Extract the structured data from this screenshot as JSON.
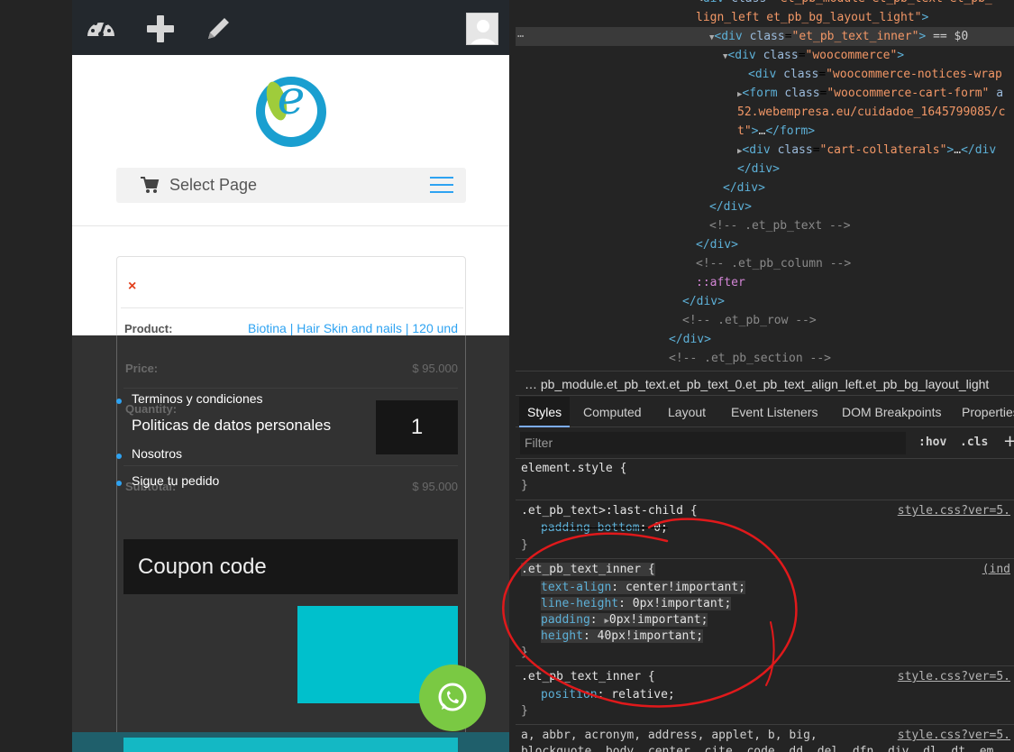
{
  "site": {
    "logo_letter": "e",
    "nav": {
      "label": "Select Page"
    },
    "cart": {
      "remove_symbol": "×",
      "product_label": "Product:",
      "product_value": "Biotina | Hair Skin and nails | 120 und",
      "price_label": "Price:",
      "price_value": "$ 95.000",
      "quantity_label": "Quantity:",
      "quantity_value": "1",
      "subtotal_label": "Subtotal:",
      "subtotal_value": "$ 95.000",
      "coupon_placeholder": "Coupon code"
    },
    "footer_links": [
      "Terminos y condiciones",
      "Politicas de datos personales",
      "Nosotros",
      "Sigue tu pedido"
    ]
  },
  "devtools": {
    "elements": [
      {
        "indent": 0,
        "html": "<span class=\"txt\">  &lt;</span><span class=\"tag\">div</span> <span class=\"attr\">class</span>=<span class=\"aval\">\"et_pb_module et_pb_text et_pb_</span>"
      },
      {
        "indent": 0,
        "html": "<span class=\"aval\">lign_left et_pb_bg_layout_light\"</span><span class=\"tag\">&gt;</span>"
      },
      {
        "indent": 0,
        "html": "<span class=\"tri\">▼</span><span class=\"tag\">&lt;div</span> <span class=\"attr\">class</span>=<span class=\"aval\">\"et_pb_text_inner\"</span><span class=\"tag\">&gt;</span> <span class=\"txt\">== $0</span>"
      },
      {
        "indent": 0,
        "html": "<span class=\"tri\">▼</span><span class=\"tag\">&lt;div</span> <span class=\"attr\">class</span>=<span class=\"aval\">\"woocommerce\"</span><span class=\"tag\">&gt;</span>"
      },
      {
        "indent": 0,
        "html": "<span class=\"tag\">&lt;div</span> <span class=\"attr\">class</span>=<span class=\"aval\">\"woocommerce-notices-wrap</span>"
      },
      {
        "indent": 0,
        "html": "<span class=\"tri\">▶</span><span class=\"tag\">&lt;form</span> <span class=\"attr\">class</span>=<span class=\"aval\">\"woocommerce-cart-form\"</span> <span class=\"attr\">a</span>"
      },
      {
        "indent": 0,
        "html": "<span class=\"aval\">52.webempresa.eu/cuidadoe_1645799085/c</span>"
      },
      {
        "indent": 0,
        "html": "<span class=\"aval\">t\"</span><span class=\"tag\">&gt;</span><span class=\"txt\">…</span><span class=\"tag\">&lt;/form&gt;</span>"
      },
      {
        "indent": 0,
        "html": "<span class=\"tri\">▶</span><span class=\"tag\">&lt;div</span> <span class=\"attr\">class</span>=<span class=\"aval\">\"cart-collaterals\"</span><span class=\"tag\">&gt;</span><span class=\"txt\">…</span><span class=\"tag\">&lt;/div</span>"
      },
      {
        "indent": 0,
        "html": "<span class=\"tag\">&lt;/div&gt;</span>"
      },
      {
        "indent": 0,
        "html": "<span class=\"tag\">&lt;/div&gt;</span>"
      },
      {
        "indent": 0,
        "html": "<span class=\"tag\">&lt;/div&gt;</span>"
      },
      {
        "indent": 0,
        "html": "<span class=\"cmt\">&lt;!-- .et_pb_text --&gt;</span>"
      },
      {
        "indent": 0,
        "html": "<span class=\"tag\">&lt;/div&gt;</span>"
      },
      {
        "indent": 0,
        "html": "<span class=\"cmt\">&lt;!-- .et_pb_column --&gt;</span>"
      },
      {
        "indent": 0,
        "html": "<span class=\"pseudo\">::after</span>"
      },
      {
        "indent": 0,
        "html": "<span class=\"tag\">&lt;/div&gt;</span>"
      },
      {
        "indent": 0,
        "html": "<span class=\"cmt\">&lt;!-- .et_pb_row --&gt;</span>"
      },
      {
        "indent": 0,
        "html": "<span class=\"tag\">&lt;/div&gt;</span>"
      },
      {
        "indent": 0,
        "html": "<span class=\"cmt\">&lt;!-- .et_pb_section --&gt;</span>"
      }
    ],
    "ellipsis": "…",
    "breadcrumb": "… pb_module.et_pb_text.et_pb_text_0.et_pb_text_align_left.et_pb_bg_layout_light",
    "tabs": [
      "Styles",
      "Computed",
      "Layout",
      "Event Listeners",
      "DOM Breakpoints",
      "Properties"
    ],
    "filter_placeholder": "Filter",
    "hov": ":hov",
    "cls": ".cls",
    "plus": "+",
    "rules": {
      "element_style": "element.style {",
      "close": "}",
      "r1_selector": ".et_pb_text>:last-child {",
      "r1_prop": "padding-bottom",
      "r1_val": "0;",
      "r1_src": "style.css?ver=5.",
      "r2_selector": ".et_pb_text_inner {",
      "r2_src": "(ind",
      "r2_props": [
        {
          "name": "text-align",
          "value": "center!important;"
        },
        {
          "name": "line-height",
          "value": "0px!important;"
        },
        {
          "name": "padding",
          "value": "0px!important;"
        },
        {
          "name": "height",
          "value": "40px!important;"
        }
      ],
      "r3_selector": ".et_pb_text_inner {",
      "r3_prop": "position",
      "r3_val": "relative;",
      "r3_src": "style.css?ver=5.",
      "r4_selector": "a, abbr, acronym, address, applet, b, big,",
      "r4_second": "blockquote, body, center, cite, code, dd, del, dfn, div, dl, dt, em,",
      "r4_src": "style.css?ver=5."
    }
  },
  "colors": {
    "accent": "#2ea3f2",
    "teal": "#00c0cc",
    "whatsapp": "#7ac943",
    "annotation": "#e0191b"
  }
}
